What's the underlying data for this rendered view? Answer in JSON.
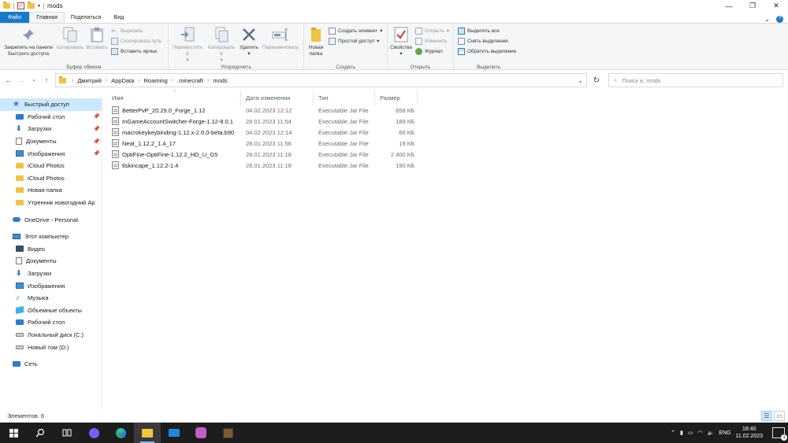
{
  "window": {
    "title": "mods",
    "controls": {
      "minimize": "—",
      "maximize": "❐",
      "close": "✕"
    }
  },
  "tabs": [
    {
      "label": "Файл"
    },
    {
      "label": "Главная"
    },
    {
      "label": "Поделиться"
    },
    {
      "label": "Вид"
    }
  ],
  "ribbon": {
    "clipboard": {
      "label": "Буфер обмена",
      "pin": "Закрепить на панели быстрого доступа",
      "copy": "Копировать",
      "paste": "Вставить",
      "cut": "Вырезать",
      "copy_path": "Скопировать путь",
      "paste_shortcut": "Вставить ярлык"
    },
    "organize": {
      "label": "Упорядочить",
      "move_to": "Переместить в",
      "copy_to": "Копировать в",
      "delete": "Удалить",
      "rename": "Переименовать"
    },
    "new": {
      "label": "Создать",
      "new_folder": "Новая папка",
      "new_item": "Создать элемент",
      "easy_access": "Простой доступ"
    },
    "open": {
      "label": "Открыть",
      "properties": "Свойства",
      "open": "Открыть",
      "edit": "Изменить",
      "history": "Журнал"
    },
    "select": {
      "label": "Выделить",
      "select_all": "Выделить все",
      "select_none": "Снять выделение",
      "invert": "Обратить выделение"
    }
  },
  "address": {
    "breadcrumbs": [
      "Дмитрий",
      "AppData",
      "Roaming",
      ".minecraft",
      "mods"
    ],
    "search_placeholder": "Поиск в: mods"
  },
  "nav": {
    "quick_access": "Быстрый доступ",
    "pinned": [
      {
        "label": "Рабочий стол",
        "icon": "desktop-icon"
      },
      {
        "label": "Загрузки",
        "icon": "downloads-icon"
      },
      {
        "label": "Документы",
        "icon": "documents-icon"
      },
      {
        "label": "Изображения",
        "icon": "pictures-icon"
      }
    ],
    "recent": [
      {
        "label": "iCloud Photos"
      },
      {
        "label": "iCloud Photos"
      },
      {
        "label": "Новая папка"
      },
      {
        "label": "Утренник новогодний Ар"
      }
    ],
    "onedrive": "OneDrive - Personal",
    "this_pc": "Этот компьютер",
    "pc_items": [
      {
        "label": "Видео"
      },
      {
        "label": "Документы"
      },
      {
        "label": "Загрузки"
      },
      {
        "label": "Изображения"
      },
      {
        "label": "Музыка"
      },
      {
        "label": "Объемные объекты"
      },
      {
        "label": "Рабочий стол"
      },
      {
        "label": "Локальный диск (C:)"
      },
      {
        "label": "Новый том (D:)"
      }
    ],
    "network": "Сеть"
  },
  "columns": {
    "name": "Имя",
    "date": "Дата изменения",
    "type": "Тип",
    "size": "Размер"
  },
  "files": [
    {
      "name": "BetterPvP_20.29.0_Forge_1.12",
      "date": "04.02.2023 12:12",
      "type": "Executable Jar File",
      "size": "658 КБ"
    },
    {
      "name": "InGameAccountSwitcher-Forge-1.12-8.0.1",
      "date": "28.01.2023 11:54",
      "type": "Executable Jar File",
      "size": "189 КБ"
    },
    {
      "name": "macrokeykeybinding-1.12.x-2.0.0-beta.b90",
      "date": "04.02.2023 12:14",
      "type": "Executable Jar File",
      "size": "66 КБ"
    },
    {
      "name": "Neat_1.12.2_1.4_17",
      "date": "28.01.2023 11:56",
      "type": "Executable Jar File",
      "size": "19 КБ"
    },
    {
      "name": "OptiFine-OptiFine-1.12.2_HD_U_G5",
      "date": "28.01.2023 11:18",
      "type": "Executable Jar File",
      "size": "2 400 КБ"
    },
    {
      "name": "tlskincape_1.12.2-1.4",
      "date": "28.01.2023 11:18",
      "type": "Executable Jar File",
      "size": "190 КБ"
    }
  ],
  "status": {
    "items": "Элементов: 6"
  },
  "taskbar": {
    "lang": "ENG",
    "time": "18:40",
    "date": "11.02.2023",
    "notifications": "1"
  }
}
